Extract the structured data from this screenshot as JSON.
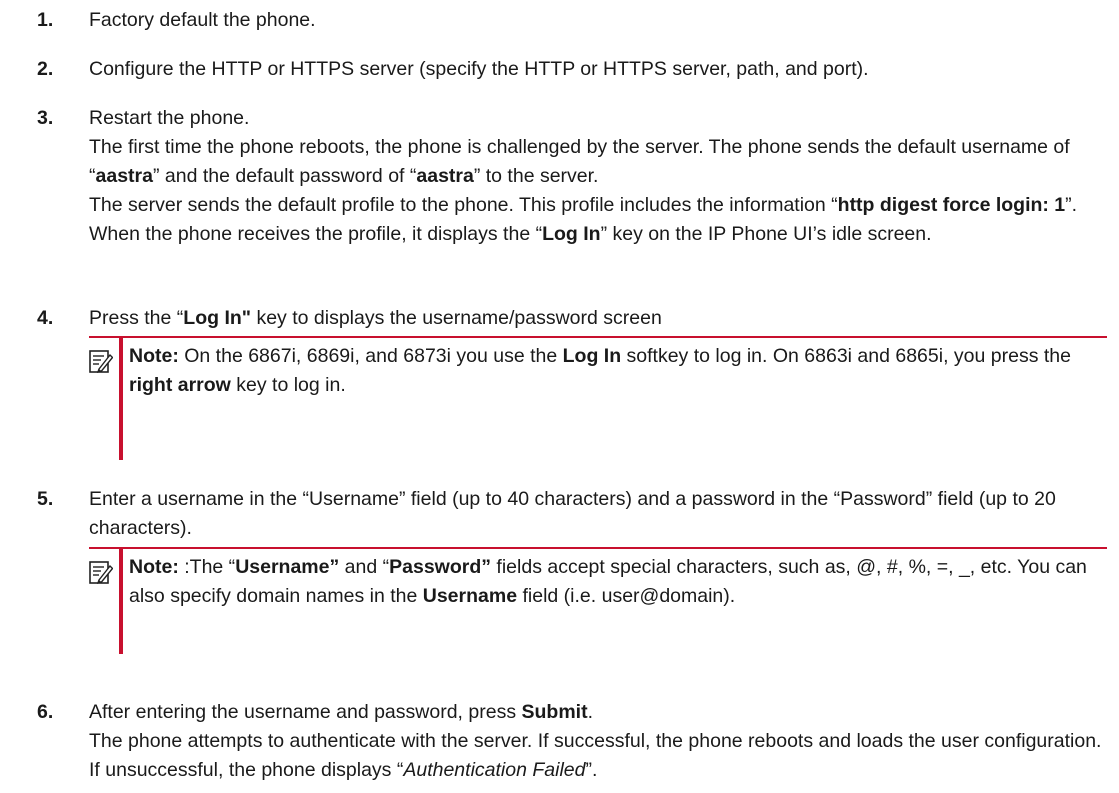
{
  "steps": [
    {
      "num": "1.",
      "text": "Factory default the phone."
    },
    {
      "num": "2.",
      "text": "Configure the HTTP or HTTPS server (specify the HTTP or HTTPS server, path, and port)."
    },
    {
      "num": "3.",
      "title": "Restart the phone.",
      "p1_a": "The first time the phone reboots, the phone is challenged by the server. The phone sends the default username of “",
      "p1_b": "aastra",
      "p1_c": "” and the default password of “",
      "p1_d": "aastra",
      "p1_e": "” to the server.",
      "p2_a": "The server sends the default profile to the phone. This profile includes the information “",
      "p2_b": "http digest force login: 1",
      "p2_c": "”. When the phone receives the profile, it displays the “",
      "p2_d": "Log In",
      "p2_e": "” key on the IP Phone UI’s idle screen."
    },
    {
      "num": "4.",
      "a": "Press the “",
      "b": "Log In\"",
      "c": " key to displays the username/password screen"
    },
    {
      "num": "5.",
      "text": "Enter a username in the “Username” field (up to 40 characters) and a password in the “Password” field (up to 20 characters)."
    },
    {
      "num": "6.",
      "a": "After entering the username and password, press ",
      "b": "Submit",
      "c": ".",
      "p_a": "The phone attempts to authenticate with the server. If successful, the phone reboots and loads the user configuration. If unsuccessful, the phone displays “",
      "p_b": "Authentication Failed",
      "p_c": "”."
    }
  ],
  "note1": {
    "label": "Note:",
    "t1": " On the 6867i, 6869i, and 6873i you use the ",
    "b1": "Log In",
    "t2": " softkey to log in. On 6863i and 6865i, you press the ",
    "b2": "right arrow",
    "t3": " key to log in."
  },
  "note2": {
    "label": "Note:",
    "t1": " :The “",
    "b1": "Username”",
    "t2": " and “",
    "b2": "Password”",
    "t3": " fields accept special characters, such as, @, #, %, =, _, etc. You can also specify domain names in the ",
    "b3": "Username",
    "t4": " field (i.e. user@domain)."
  },
  "colors": {
    "accent": "#c8102e",
    "text": "#1a1a1a"
  },
  "icons": {
    "note": "note-pencil-icon"
  }
}
